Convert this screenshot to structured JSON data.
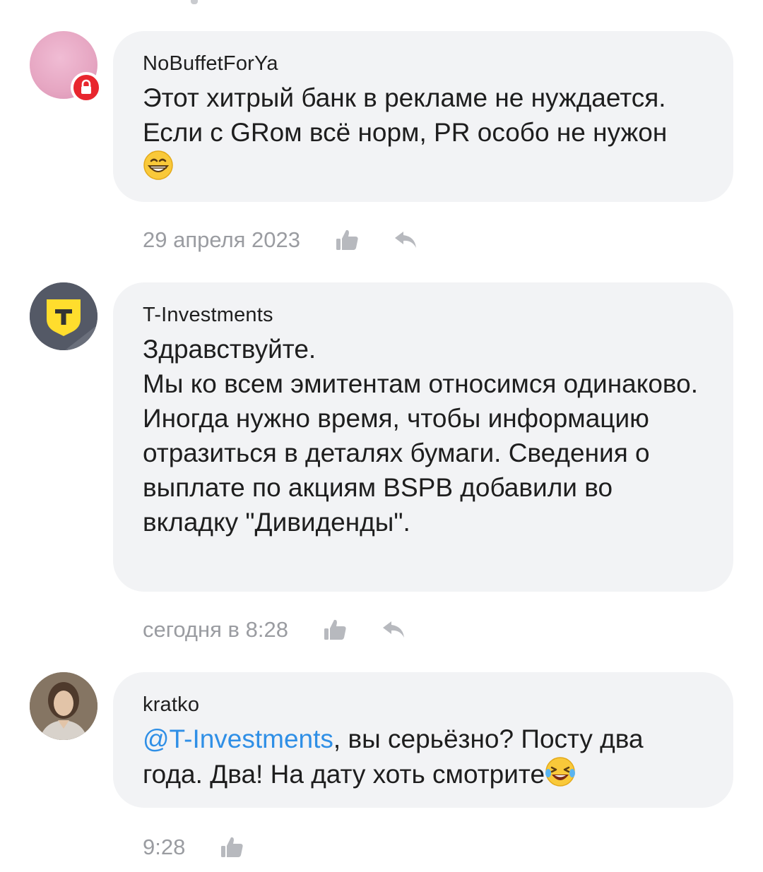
{
  "comments": [
    {
      "author": "NoBuffetForYa",
      "text": "Этот хитрый банк в рекламе не нуждается. Если с GRом всё норм, PR особо не нужон",
      "emoji": "grinning-face-emoji",
      "date": "29 апреля 2023",
      "avatar": "pink-avatar",
      "badge": "lock-icon",
      "actions": [
        "like-icon",
        "reply-icon"
      ]
    },
    {
      "author": "T-Investments",
      "text": "Здравствуйте.\nМы ко всем эмитентам относимся одинаково. Иногда нужно время, чтобы информацию отразиться в деталях бумаги. Сведения о выплате по акциям BSPB добавили во вкладку \"Дивиденды\".",
      "date": "сегодня в 8:28",
      "avatar": "t-investments-logo",
      "actions": [
        "like-icon",
        "reply-icon"
      ]
    },
    {
      "author": "kratko",
      "mention": "@T-Investments",
      "text": ", вы серьёзно? Посту два года. Два! На дату хоть смотрите",
      "emoji": "laughing-tears-emoji",
      "date": "9:28",
      "avatar": "user-photo",
      "actions": [
        "like-icon"
      ]
    }
  ],
  "colors": {
    "bubble": "#f2f3f5",
    "mention": "#2f8fe6",
    "meta": "#9a9ca1",
    "badge": "#e8262e",
    "brand_yellow": "#ffdd2d"
  }
}
